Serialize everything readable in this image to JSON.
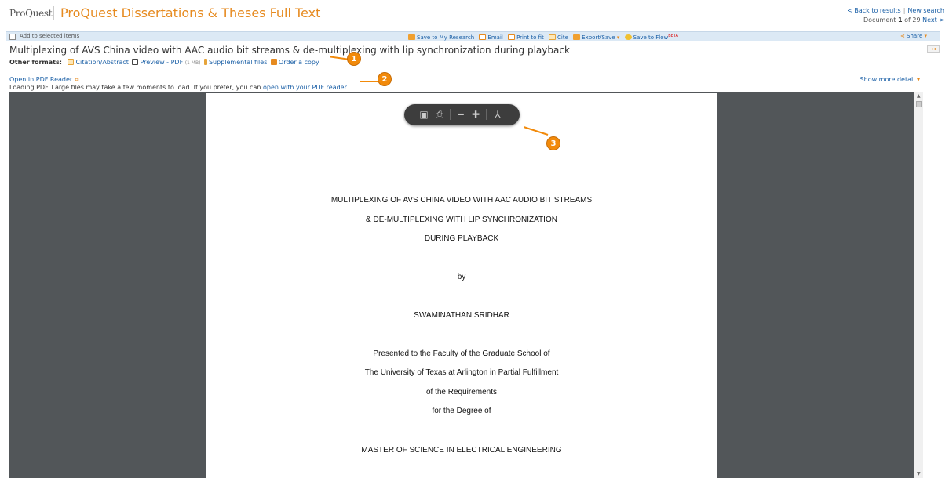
{
  "header": {
    "logo_text": "ProQuest",
    "product_title": "ProQuest Dissertations & Theses Full Text",
    "back_to_results": "< Back to results",
    "new_search": "New search",
    "document_label": "Document",
    "document_current": "1",
    "document_of": "of 29",
    "next": "Next >"
  },
  "toolbar": {
    "add_label": "Add to selected items",
    "save_research": "Save to My Research",
    "email": "Email",
    "print": "Print to fit",
    "cite": "Cite",
    "export": "Export/Save",
    "save_flow": "Save to Flow",
    "beta": "BETA",
    "share": "Share"
  },
  "document": {
    "title": "Multiplexing of AVS China video with AAC audio bit streams & de-multiplexing with lip synchronization during playback",
    "other_formats_label": "Other formats:",
    "formats": {
      "citation": "Citation/Abstract",
      "preview": "Preview - PDF",
      "preview_size": "(1 MB)",
      "supplemental": "Supplemental files",
      "order": "Order a copy"
    },
    "open_pdf": "Open in PDF Reader",
    "loading_text": "Loading PDF. Large files may take a few moments to load. If you prefer, you can",
    "loading_link": "open with your PDF reader.",
    "show_more": "Show more detail"
  },
  "pdf": {
    "lines": [
      "MULTIPLEXING OF AVS CHINA VIDEO WITH AAC AUDIO BIT STREAMS",
      "& DE-MULTIPLEXING WITH LIP SYNCHRONIZATION",
      "DURING PLAYBACK",
      "by",
      "SWAMINATHAN SRIDHAR",
      "Presented to the Faculty of the Graduate School of",
      "The University of Texas at Arlington in Partial Fulfillment",
      "of the Requirements",
      "for the Degree of",
      "MASTER OF SCIENCE IN ELECTRICAL ENGINEERING"
    ]
  },
  "callouts": [
    "1",
    "2",
    "3"
  ],
  "colors": {
    "brand_orange": "#e68a1f",
    "link_blue": "#1a5fa6",
    "toolbar_bg": "#dce9f5",
    "viewer_bg": "#525659",
    "callout": "#f28a0a"
  }
}
